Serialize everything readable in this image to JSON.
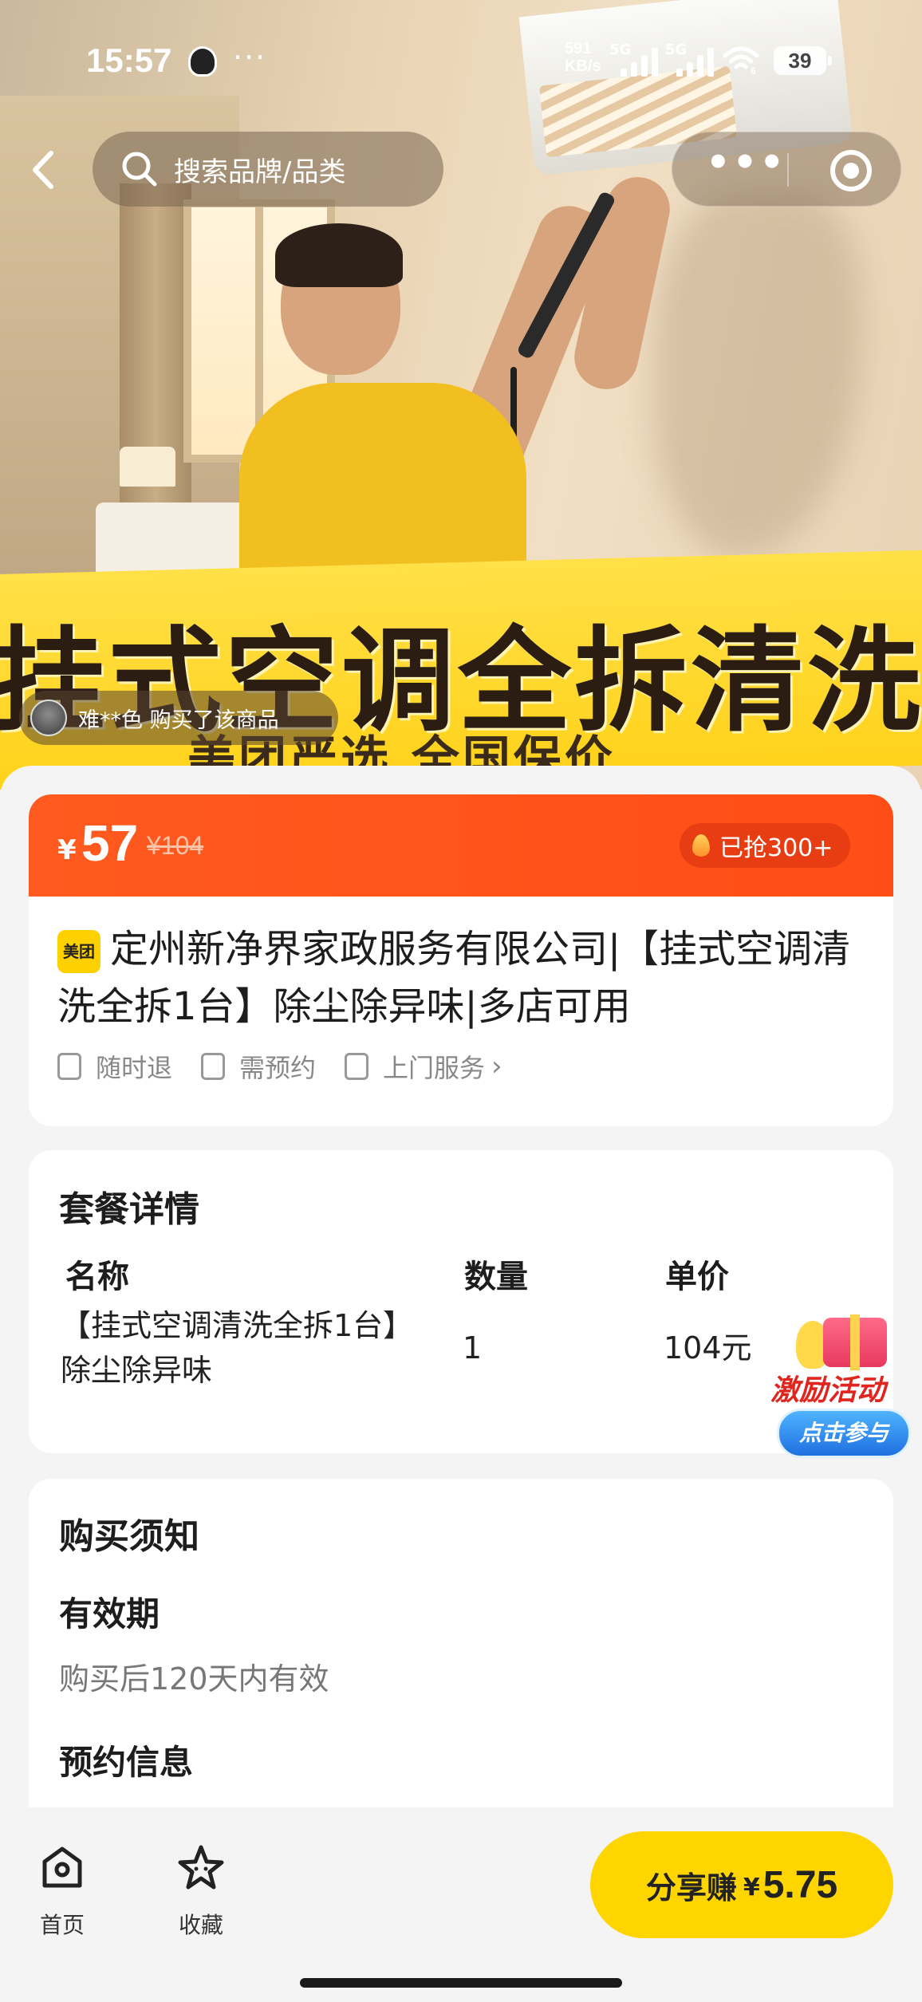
{
  "status_bar": {
    "time": "15:57",
    "more": "···",
    "net_speed_value": "591",
    "net_speed_unit": "KB/s",
    "sim1": "5G",
    "sim2": "5G",
    "wifi_badge": "6",
    "battery": "39"
  },
  "nav": {
    "search_placeholder": "搜索品牌/品类",
    "more": "•••"
  },
  "hero": {
    "banner_title": "挂式空调全拆清洗",
    "banner_subtitle": "美团严选 全国保价",
    "buyer_notice": "难**色 购买了该商品"
  },
  "product": {
    "currency": "¥",
    "price": "57",
    "original_price": "¥104",
    "sold": "已抢300+",
    "brand_badge": "美团",
    "title": "定州新净界家政服务有限公司|【挂式空调清洗全拆1台】除尘除异味|多店可用",
    "tags": [
      "随时退",
      "需预约",
      "上门服务"
    ],
    "tags_chevron": "›"
  },
  "package": {
    "heading": "套餐详情",
    "columns": [
      "名称",
      "数量",
      "单价"
    ],
    "rows": [
      {
        "name_line1": "【挂式空调清洗全拆1台】",
        "name_line2": "除尘除异味",
        "qty": "1",
        "price": "104元"
      }
    ]
  },
  "promo": {
    "title": "激励活动",
    "button": "点击参与"
  },
  "notice": {
    "heading": "购买须知",
    "validity_label": "有效期",
    "validity_value": "购买后120天内有效",
    "booking_label": "预约信息"
  },
  "bottom_bar": {
    "home": "首页",
    "favorite": "收藏",
    "share_label": "分享赚",
    "share_currency": "¥",
    "share_amount": "5.75"
  },
  "colors": {
    "brand_yellow": "#ffd500",
    "price_orange": "#ff5a1f",
    "background": "#f4f4f4"
  }
}
